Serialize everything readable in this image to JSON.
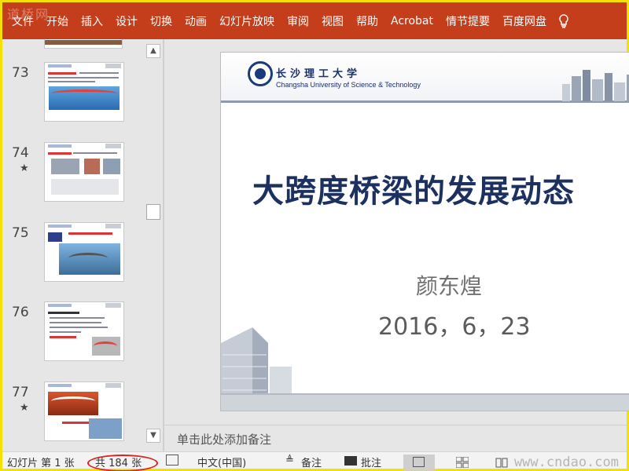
{
  "watermark_top": "道桥网",
  "watermark_bottom": "www.cndao.com",
  "ribbon": {
    "tabs": [
      "文件",
      "开始",
      "插入",
      "设计",
      "切换",
      "动画",
      "幻灯片放映",
      "审阅",
      "视图",
      "帮助",
      "Acrobat",
      "情节提要",
      "百度网盘"
    ],
    "icons": [
      "lightbulb-icon"
    ],
    "color": "#c43e1c"
  },
  "thumbnails": [
    {
      "number": "73",
      "star": ""
    },
    {
      "number": "74",
      "star": "★"
    },
    {
      "number": "75",
      "star": ""
    },
    {
      "number": "76",
      "star": ""
    },
    {
      "number": "77",
      "star": "★"
    }
  ],
  "slide": {
    "university_cn": "长沙理工大学",
    "university_en": "Changsha University of Science & Technology",
    "title": "大跨度桥梁的发展动态",
    "author": "颜东煌",
    "date": "2016，6，23"
  },
  "notes": {
    "placeholder": "单击此处添加备注"
  },
  "status_bar": {
    "slide_info": "幻灯片 第 1 张",
    "total": "共 184 张",
    "language": "中文(中国)",
    "notes_label": "备注",
    "comments_label": "批注",
    "highlight_color": "#e0201c"
  }
}
